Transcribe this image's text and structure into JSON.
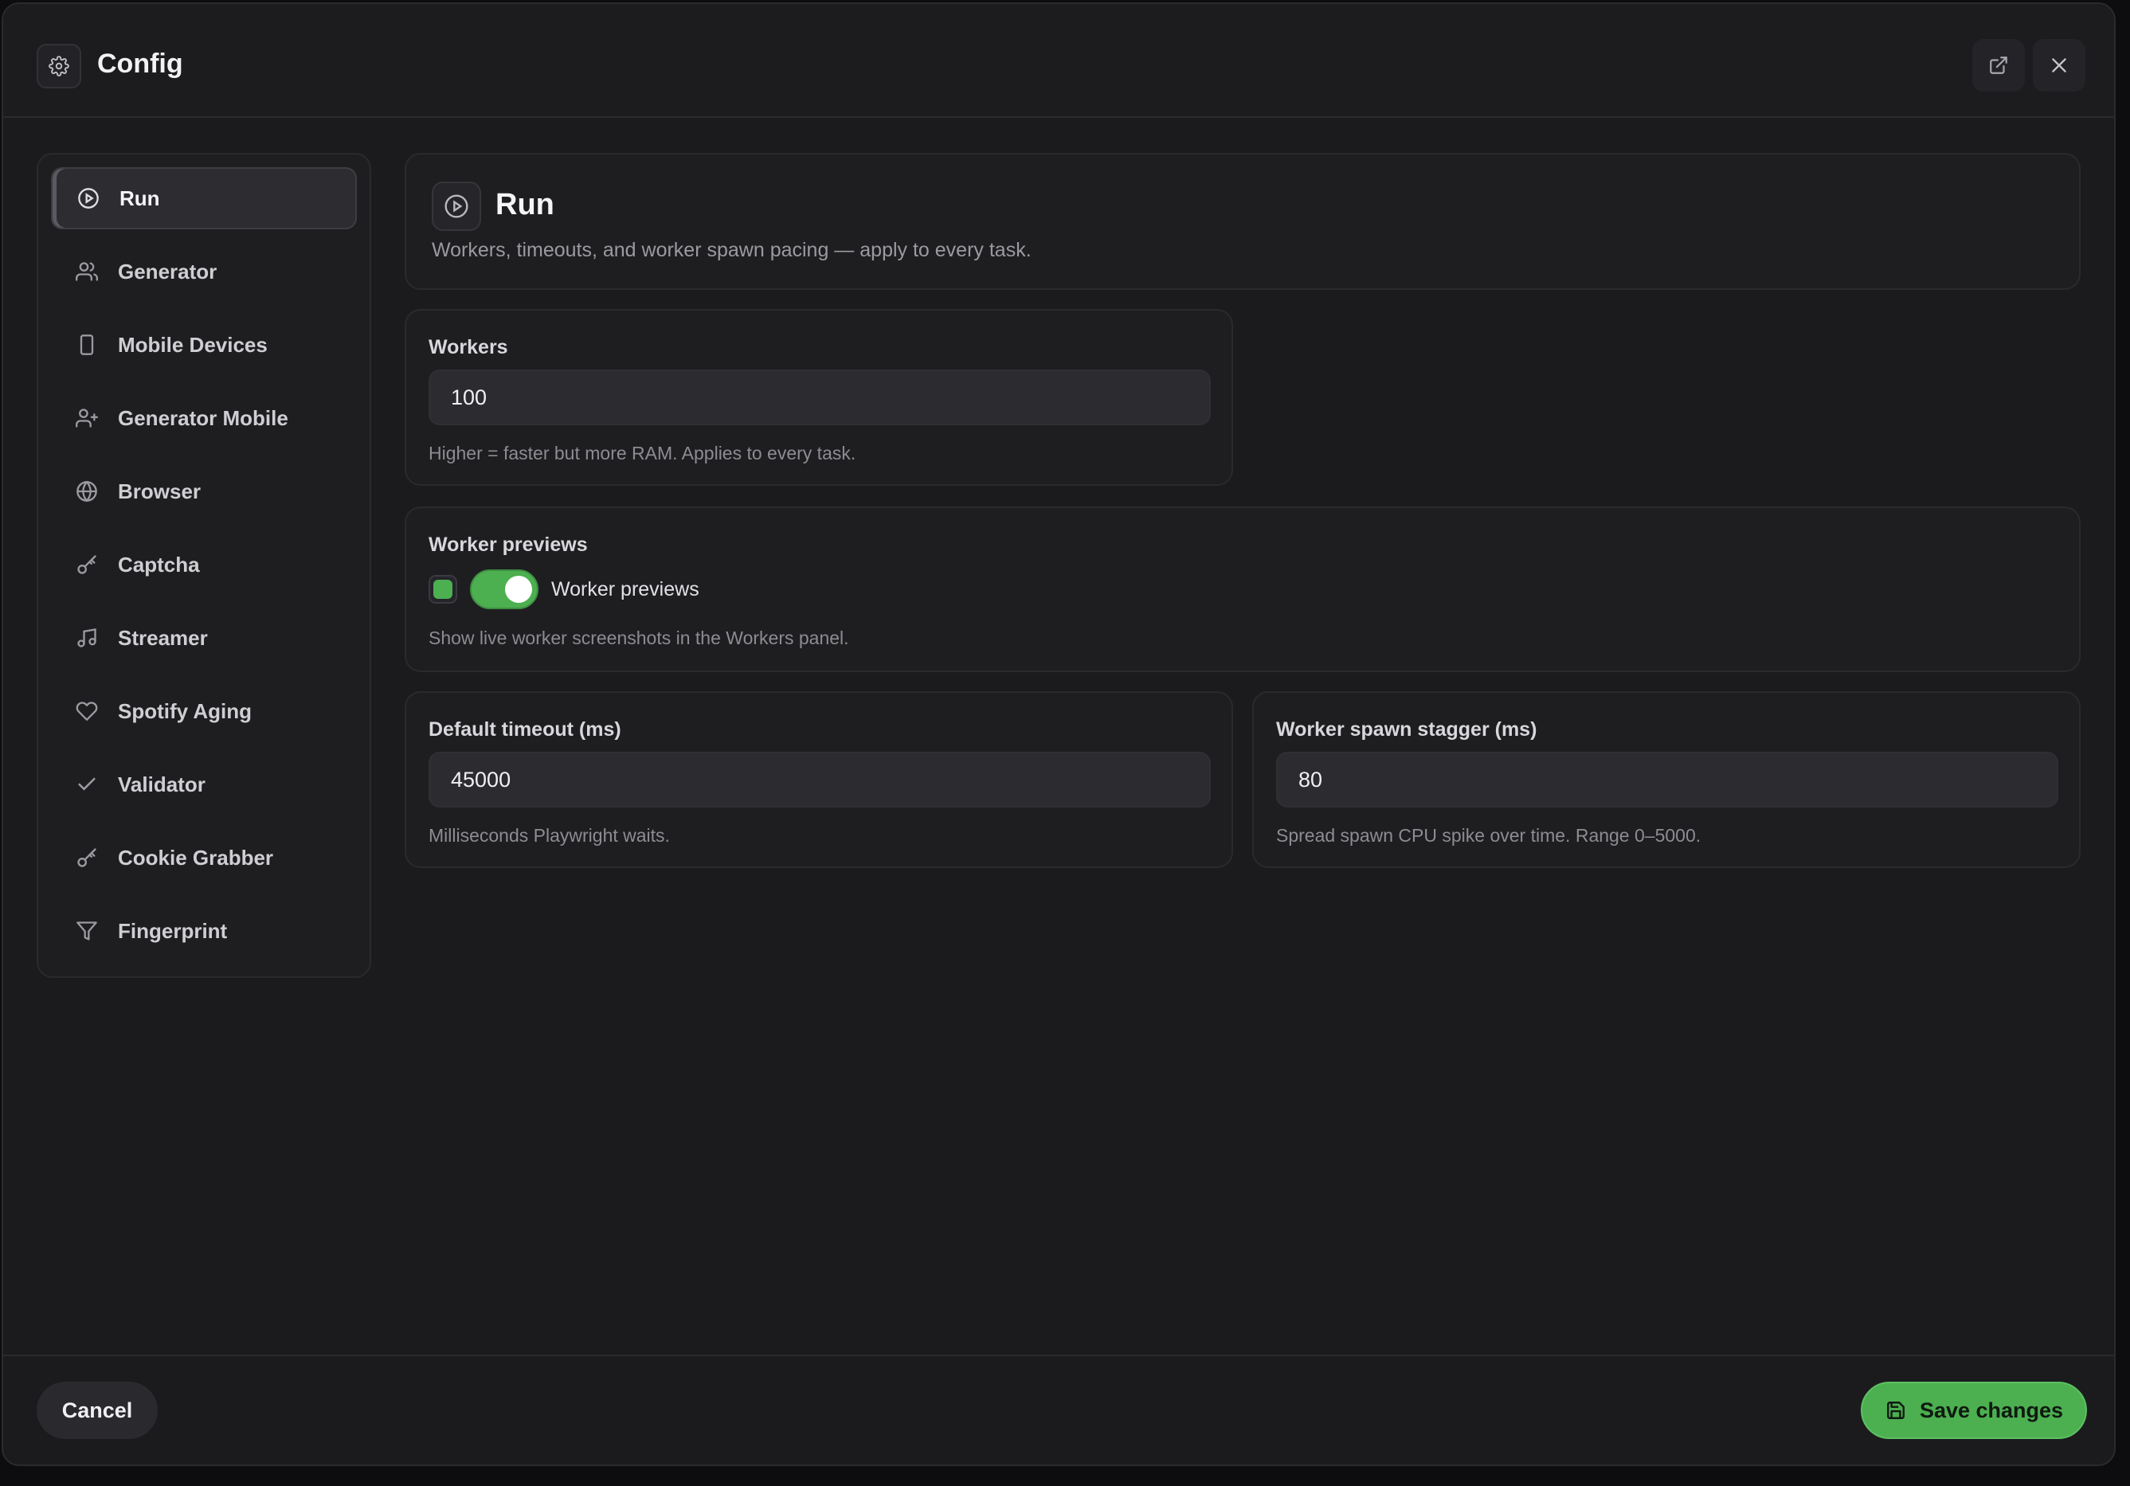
{
  "window": {
    "title": "Config",
    "icons": {
      "app": "gear-icon",
      "popout": "external-link-icon",
      "close": "close-icon"
    }
  },
  "sidebar": {
    "items": [
      {
        "label": "Run",
        "icon": "play-circle-icon",
        "active": true
      },
      {
        "label": "Generator",
        "icon": "users-icon",
        "active": false
      },
      {
        "label": "Mobile Devices",
        "icon": "smartphone-icon",
        "active": false
      },
      {
        "label": "Generator Mobile",
        "icon": "user-plus-icon",
        "active": false
      },
      {
        "label": "Browser",
        "icon": "globe-icon",
        "active": false
      },
      {
        "label": "Captcha",
        "icon": "key-icon",
        "active": false
      },
      {
        "label": "Streamer",
        "icon": "music-icon",
        "active": false
      },
      {
        "label": "Spotify Aging",
        "icon": "heart-icon",
        "active": false
      },
      {
        "label": "Validator",
        "icon": "check-icon",
        "active": false
      },
      {
        "label": "Cookie Grabber",
        "icon": "key-icon",
        "active": false
      },
      {
        "label": "Fingerprint",
        "icon": "filter-icon",
        "active": false
      }
    ]
  },
  "section": {
    "title": "Run",
    "description": "Workers, timeouts, and worker spawn pacing — apply to every task.",
    "icon": "play-circle-icon"
  },
  "fields": {
    "workers": {
      "label": "Workers",
      "value": "100",
      "hint": "Higher = faster but more RAM. Applies to every task."
    },
    "worker_previews": {
      "label": "Worker previews",
      "toggle_label": "Worker previews",
      "enabled": true,
      "hint": "Show live worker screenshots in the Workers panel."
    },
    "default_timeout": {
      "label": "Default timeout (ms)",
      "value": "45000",
      "hint": "Milliseconds Playwright waits."
    },
    "spawn_stagger": {
      "label": "Worker spawn stagger (ms)",
      "value": "80",
      "hint": "Spread spawn CPU spike over time. Range 0–5000."
    }
  },
  "footer": {
    "cancel_label": "Cancel",
    "save_label": "Save changes",
    "save_icon": "save-icon"
  },
  "colors": {
    "accent": "#4caf50",
    "background": "#1b1b1e",
    "panel": "#1e1e21",
    "input": "#2b2b30"
  }
}
